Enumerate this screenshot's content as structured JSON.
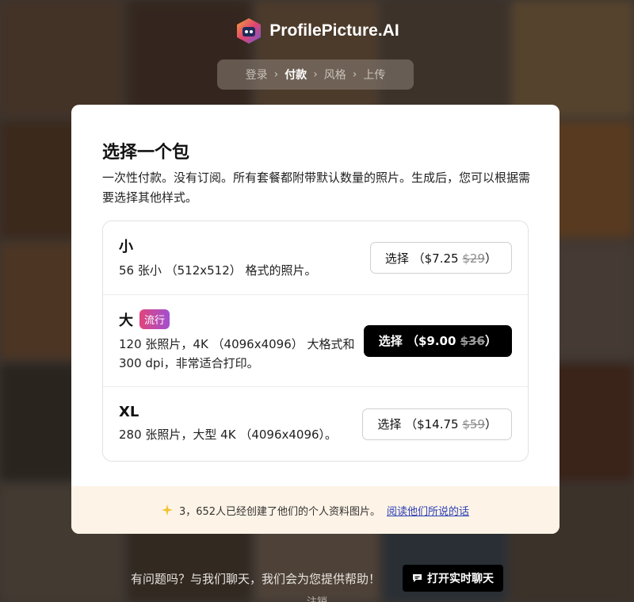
{
  "brand": {
    "name": "ProfilePicture.AI"
  },
  "steps": [
    {
      "label": "登录",
      "active": false
    },
    {
      "label": "付款",
      "active": true
    },
    {
      "label": "风格",
      "active": false
    },
    {
      "label": "上传",
      "active": false
    }
  ],
  "card": {
    "title": "选择一个包",
    "description": "一次性付款。没有订阅。所有套餐都附带默认数量的照片。生成后，您可以根据需要选择其他样式。",
    "packages": [
      {
        "name": "小",
        "badge": "",
        "detail": "56 张小 （512x512） 格式的照片。",
        "button_label": "选择 （$7.25 ",
        "old_price": "$29",
        "button_close": "）"
      },
      {
        "name": "大",
        "badge": "流行",
        "detail": "120 张照片，4K （4096x4096） 大格式和 300 dpi，非常适合打印。",
        "button_label": "选择 （$9.00 ",
        "old_price": "$36",
        "button_close": "）"
      },
      {
        "name": "XL",
        "badge": "",
        "detail": "280 张照片，大型 4K （4096x4096）。",
        "button_label": "选择 （$14.75 ",
        "old_price": "$59",
        "button_close": "）"
      }
    ],
    "footer": {
      "count_text": "3，652人已经创建了他们的个人资料图片。",
      "link_text": "阅读他们所说的话"
    }
  },
  "help": {
    "text": "有问题吗？与我们聊天，我们会为您提供帮助！",
    "chat_button": "打开实时聊天"
  },
  "logout": "注销",
  "colors": {
    "badge_gradient_start": "#e0457b",
    "badge_gradient_end": "#a24fd1",
    "footer_bg": "#fdf3e6",
    "link": "#2b3fb5"
  }
}
